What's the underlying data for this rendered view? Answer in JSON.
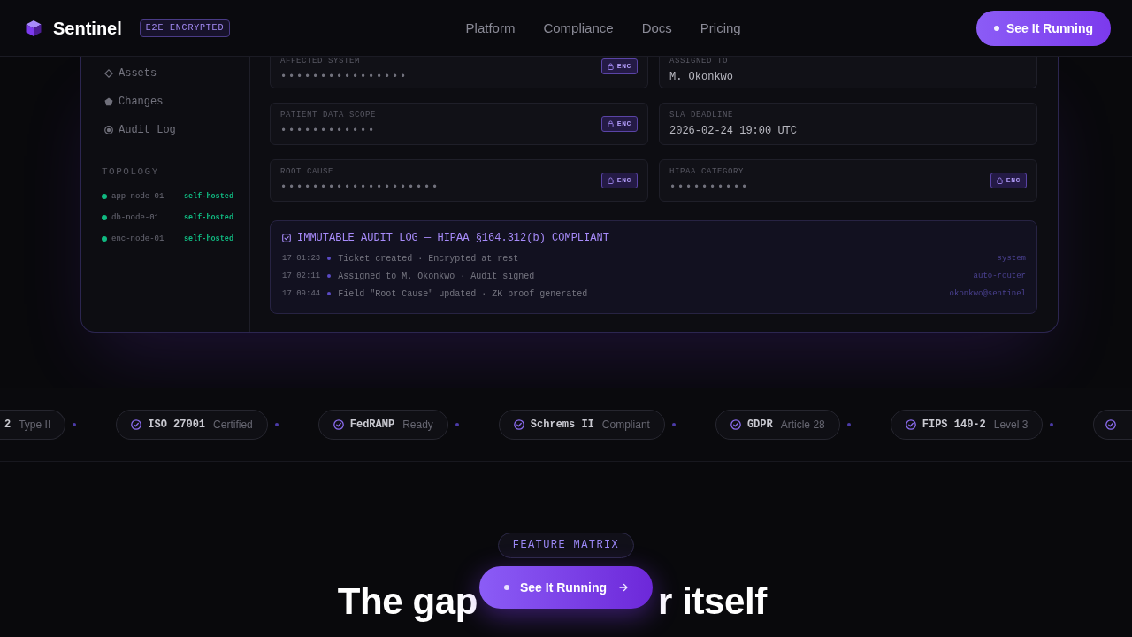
{
  "nav": {
    "brand": "Sentinel",
    "badge": "E2E ENCRYPTED",
    "links": [
      "Platform",
      "Compliance",
      "Docs",
      "Pricing"
    ],
    "cta": "See It Running"
  },
  "dashboard": {
    "cut_at_top": true,
    "sidebar": {
      "items": [
        "Assets",
        "Changes",
        "Audit Log"
      ],
      "topology_title": "TOPOLOGY",
      "nodes": [
        {
          "name": "app-node-01",
          "tag": "self-hosted",
          "color": "#10b981"
        },
        {
          "name": "db-node-01",
          "tag": "self-hosted",
          "color": "#10b981"
        },
        {
          "name": "enc-node-01",
          "tag": "self-hosted",
          "color": "#10b981"
        }
      ]
    },
    "fields": [
      {
        "label": "AFFECTED SYSTEM",
        "value": "••••••••••••••••",
        "badge": "ENC"
      },
      {
        "label": "ASSIGNED TO",
        "value": "M. Okonkwo"
      },
      {
        "label": "PATIENT DATA SCOPE",
        "value": "••••••••••••",
        "badge": "ENC"
      },
      {
        "label": "SLA DEADLINE",
        "value": "2026-02-24 19:00 UTC"
      },
      {
        "label": "ROOT CAUSE",
        "value": "••••••••••••••••••••",
        "badge": "ENC"
      },
      {
        "label": "HIPAA CATEGORY",
        "value": "••••••••••",
        "badge": "ENC"
      }
    ],
    "audit_log": {
      "title": "IMMUTABLE AUDIT LOG — HIPAA §164.312(b) COMPLIANT",
      "entries": [
        {
          "time": "17:01:23",
          "event": "Ticket created · Encrypted at rest",
          "actor": "system"
        },
        {
          "time": "17:02:11",
          "event": "Assigned to M. Okonkwo · Audit signed",
          "actor": "auto-router"
        },
        {
          "time": "17:09:44",
          "event": "Field \"Root Cause\" updated · ZK proof generated",
          "actor": "okonkwo@sentinel"
        }
      ]
    }
  },
  "compliance_strip": {
    "badges": [
      {
        "name": "2",
        "detail": "Type II"
      },
      {
        "name": "ISO 27001",
        "detail": "Certified"
      },
      {
        "name": "FedRAMP",
        "detail": "Ready"
      },
      {
        "name": "Schrems II",
        "detail": "Compliant"
      },
      {
        "name": "GDPR",
        "detail": "Article 28"
      },
      {
        "name": "FIPS 140-2",
        "detail": "Level 3"
      }
    ],
    "first_badge_cut_at_edge": true,
    "cut_badge_at_right_edge": true
  },
  "section": {
    "eyebrow": "FEATURE MATRIX",
    "heading_parts": [
      "The gap",
      "r itself"
    ]
  },
  "floating_cta": {
    "label": "See It Running"
  }
}
